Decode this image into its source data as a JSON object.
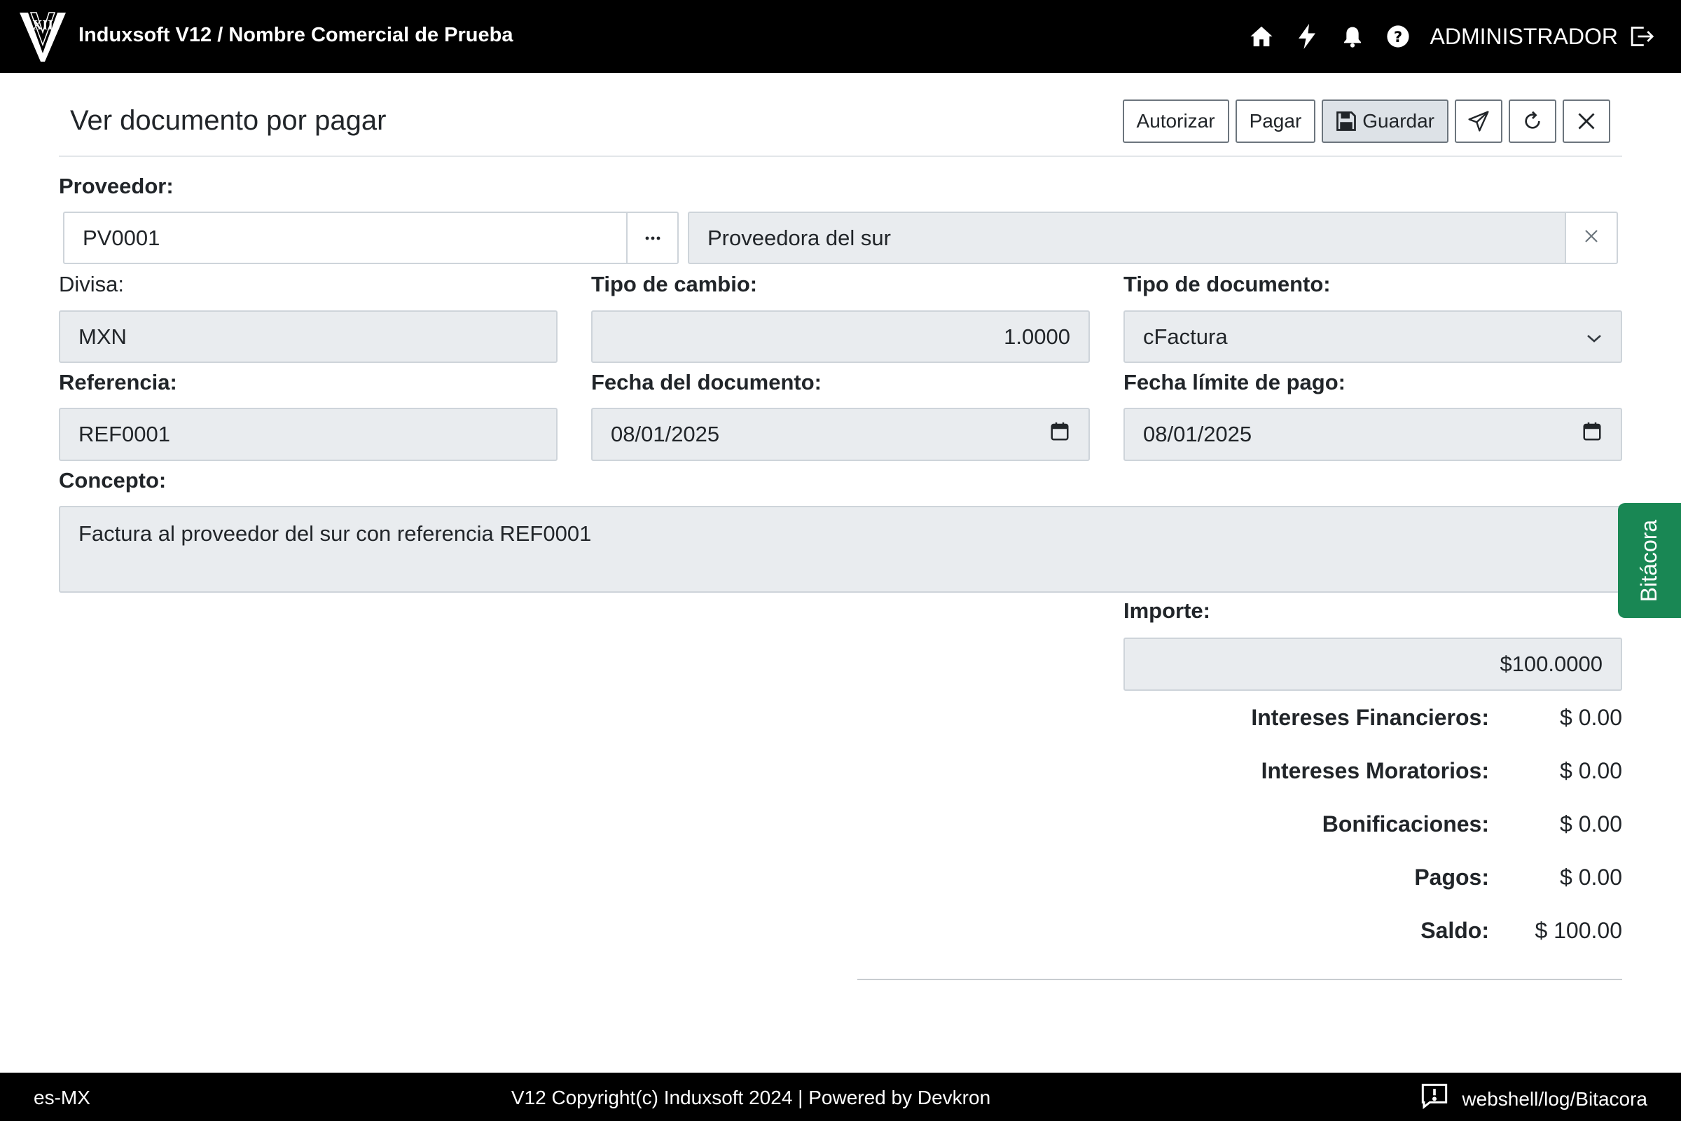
{
  "app": {
    "logo_text": "XII",
    "title": "Induxsoft V12 / Nombre Comercial de Prueba",
    "user": "ADMINISTRADOR",
    "nav_icons": [
      "home-icon",
      "bolt-icon",
      "bell-icon",
      "help-icon",
      "logout-icon"
    ]
  },
  "page": {
    "title": "Ver documento por pagar",
    "toolbar": {
      "authorize_label": "Autorizar",
      "pay_label": "Pagar",
      "save_label": "Guardar",
      "icon_buttons": [
        "send-icon",
        "refresh-icon",
        "close-icon"
      ]
    }
  },
  "form": {
    "proveedor": {
      "label": "Proveedor:",
      "code": "PV0001",
      "name": "Proveedora del sur"
    },
    "divisa": {
      "label": "Divisa:",
      "value": "MXN"
    },
    "tipo_cambio": {
      "label": "Tipo de cambio:",
      "value": "1.0000"
    },
    "tipo_documento": {
      "label": "Tipo de documento:",
      "value": "cFactura"
    },
    "referencia": {
      "label": "Referencia:",
      "value": "REF0001"
    },
    "fecha_documento": {
      "label": "Fecha del documento:",
      "value": "08/01/2025"
    },
    "fecha_limite": {
      "label": "Fecha límite de pago:",
      "value": "08/01/2025"
    },
    "concepto": {
      "label": "Concepto:",
      "value": "Factura al proveedor del sur con referencia REF0001"
    },
    "importe": {
      "label": "Importe:",
      "value": "$100.0000"
    }
  },
  "totals": [
    {
      "label": "Intereses Financieros:",
      "value": "$ 0.00"
    },
    {
      "label": "Intereses Moratorios:",
      "value": "$ 0.00"
    },
    {
      "label": "Bonificaciones:",
      "value": "$ 0.00"
    },
    {
      "label": "Pagos:",
      "value": "$ 0.00"
    },
    {
      "label": "Saldo:",
      "value": "$ 100.00"
    }
  ],
  "side_tab": {
    "label": "Bitácora"
  },
  "footer": {
    "locale": "es-MX",
    "copyright": "V12 Copyright(c) Induxsoft 2024 | Powered by Devkron",
    "log_path": "webshell/log/Bitacora"
  },
  "colors": {
    "navbar": "#000000",
    "accent_green": "#198754",
    "field_bg": "#e9ecef"
  }
}
